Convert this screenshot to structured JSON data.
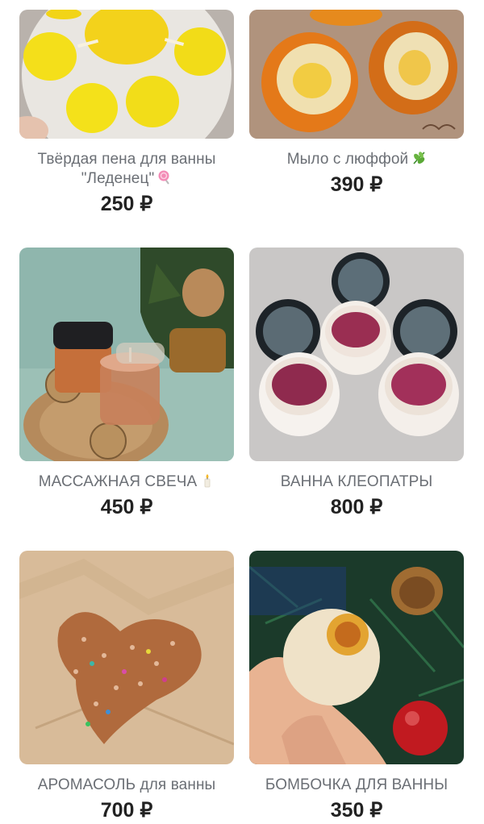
{
  "products": [
    {
      "title_line1": "Твёрдая пена для ванны",
      "title_line2": "\"Леденец\"",
      "title_icon": "lollipop-icon",
      "price": "250 ₽",
      "image": "yellow-foam-discs-photo"
    },
    {
      "title_line1": "Мыло с люффой",
      "title_icon": "herb-icon",
      "price": "390 ₽",
      "image": "loofah-soap-photo"
    },
    {
      "title_line1": "МАССАЖНАЯ СВЕЧА",
      "title_icon": "candle-icon",
      "price": "450 ₽",
      "image": "massage-candle-photo"
    },
    {
      "title_line1": "ВАННА КЛЕОПАТРЫ",
      "price": "800 ₽",
      "image": "cleopatra-bath-jars-photo"
    },
    {
      "title_line1": "АРОМАСОЛЬ для ванны",
      "price": "700 ₽",
      "image": "aroma-salt-heart-photo"
    },
    {
      "title_line1": "БОМБОЧКА ДЛЯ ВАННЫ",
      "price": "350 ₽",
      "image": "bath-bomb-photo"
    }
  ],
  "colors": {
    "title": "#6b6f75",
    "price": "#222222",
    "background": "#ffffff"
  }
}
